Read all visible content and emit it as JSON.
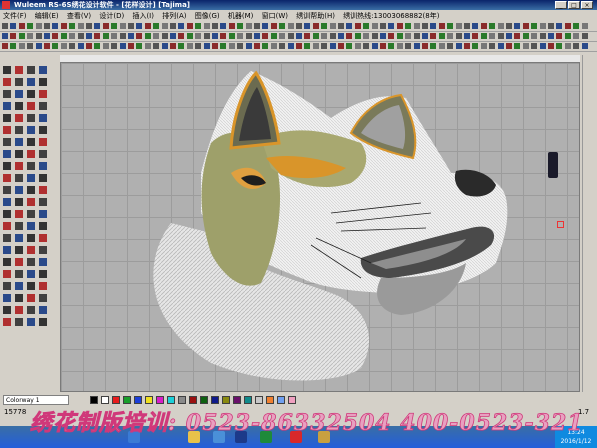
{
  "window": {
    "title": "Wuleem RS-6S绣花设计软件 - [花样设计] [Tajima]",
    "buttons": [
      "_",
      "□",
      "×"
    ]
  },
  "menu": {
    "items": [
      "文件(F)",
      "编辑(E)",
      "查看(V)",
      "设计(D)",
      "插入(I)",
      "排列(A)",
      "图像(G)",
      "机器(M)",
      "窗口(W)",
      "绣训帮助(H)"
    ],
    "hotline": "绣训热线:13003068882(8年)"
  },
  "canvas": {
    "design": "wolf-head-embroidery",
    "colors": {
      "background": "#b0b0b0",
      "grid": "#9c9c9c"
    }
  },
  "palette": {
    "colorway_label": "Colorway 1",
    "swatches": [
      "#000000",
      "#ffffff",
      "#e81c1c",
      "#1a9e2a",
      "#1c3ed8",
      "#f0e020",
      "#d81cc8",
      "#1cd0d8",
      "#8a8a8a",
      "#9a1010",
      "#106010",
      "#101a8a",
      "#8a8a10",
      "#6a106a",
      "#108a8a",
      "#c8c8c8",
      "#f08030",
      "#70a0f0",
      "#f0a0c0"
    ]
  },
  "status": {
    "stitch_count": "15778",
    "zoom": "1.7"
  },
  "banner": {
    "text": "绣花制版培训: 0523-86332504  400-0523-321"
  },
  "taskbar": {
    "clock_time": "13:24",
    "clock_date": "2016/1/12"
  }
}
